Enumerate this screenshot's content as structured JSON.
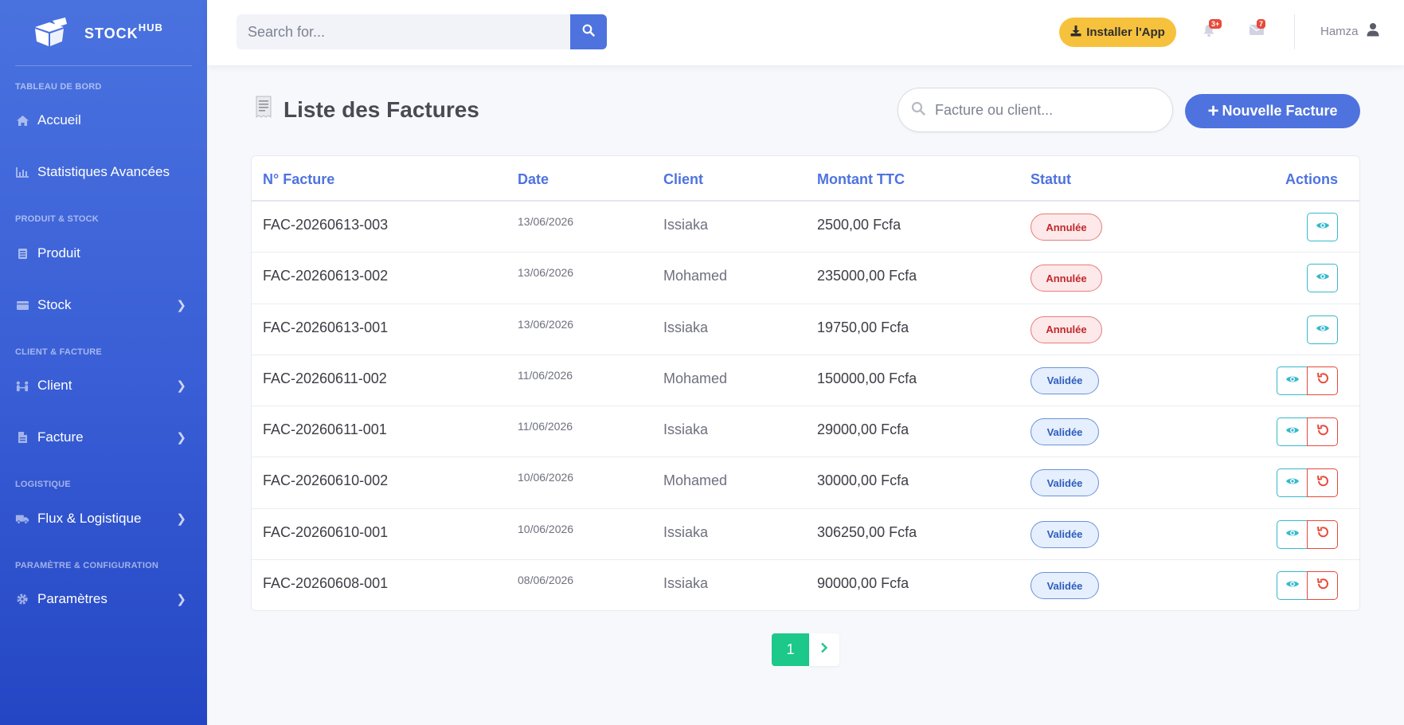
{
  "brand": {
    "name": "STOCK",
    "sup": "HUB"
  },
  "sidebar": {
    "sections": [
      {
        "heading": "TABLEAU DE BORD"
      },
      {
        "heading": "PRODUIT & STOCK"
      },
      {
        "heading": "CLIENT & FACTURE"
      },
      {
        "heading": "LOGISTIQUE"
      },
      {
        "heading": "PARAMÈTRE & CONFIGURATION"
      }
    ],
    "items": [
      {
        "label": "Accueil",
        "icon": "home-icon"
      },
      {
        "label": "Statistiques Avancées",
        "icon": "chart-icon"
      },
      {
        "label": "Produit",
        "icon": "list-icon"
      },
      {
        "label": "Stock",
        "icon": "box-icon"
      },
      {
        "label": "Client",
        "icon": "users-icon"
      },
      {
        "label": "Facture",
        "icon": "file-icon"
      },
      {
        "label": "Flux & Logistique",
        "icon": "truck-icon"
      },
      {
        "label": "Paramètres",
        "icon": "gear-icon"
      }
    ]
  },
  "topbar": {
    "search_placeholder": "Search for...",
    "install_label": "Installer l'App",
    "alerts_count": "3+",
    "messages_count": "7",
    "user_name": "Hamza"
  },
  "page": {
    "title": "Liste des Factures",
    "filter_placeholder": "Facture ou client...",
    "new_button": "Nouvelle Facture"
  },
  "table": {
    "headers": {
      "number": "N° Facture",
      "date": "Date",
      "client": "Client",
      "amount": "Montant TTC",
      "status": "Statut",
      "actions": "Actions"
    },
    "rows": [
      {
        "number": "FAC-20260613-003",
        "date": "13/06/2026",
        "client": "Issiaka",
        "amount": "2500,00 Fcfa",
        "status": "Annulée"
      },
      {
        "number": "FAC-20260613-002",
        "date": "13/06/2026",
        "client": "Mohamed",
        "amount": "235000,00 Fcfa",
        "status": "Annulée"
      },
      {
        "number": "FAC-20260613-001",
        "date": "13/06/2026",
        "client": "Issiaka",
        "amount": "19750,00 Fcfa",
        "status": "Annulée"
      },
      {
        "number": "FAC-20260611-002",
        "date": "11/06/2026",
        "client": "Mohamed",
        "amount": "150000,00 Fcfa",
        "status": "Validée"
      },
      {
        "number": "FAC-20260611-001",
        "date": "11/06/2026",
        "client": "Issiaka",
        "amount": "29000,00 Fcfa",
        "status": "Validée"
      },
      {
        "number": "FAC-20260610-002",
        "date": "10/06/2026",
        "client": "Mohamed",
        "amount": "30000,00 Fcfa",
        "status": "Validée"
      },
      {
        "number": "FAC-20260610-001",
        "date": "10/06/2026",
        "client": "Issiaka",
        "amount": "306250,00 Fcfa",
        "status": "Validée"
      },
      {
        "number": "FAC-20260608-001",
        "date": "08/06/2026",
        "client": "Issiaka",
        "amount": "90000,00 Fcfa",
        "status": "Validée"
      }
    ]
  },
  "pagination": {
    "current": "1"
  },
  "colors": {
    "primary": "#4e73df",
    "success": "#1cc88a",
    "warning": "#f6c23e",
    "danger": "#e74a3b",
    "info": "#36b9cc"
  }
}
